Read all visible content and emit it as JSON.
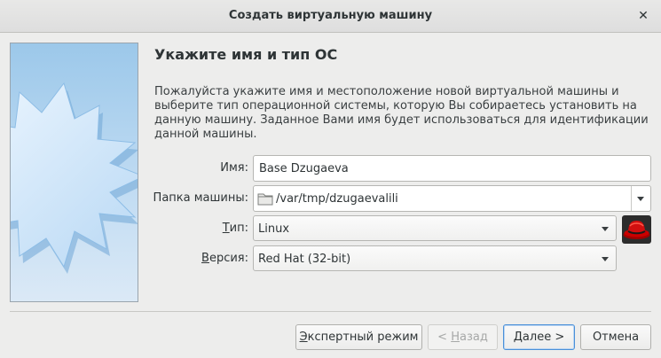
{
  "window": {
    "title": "Создать виртуальную машину",
    "close_glyph": "✕"
  },
  "page": {
    "heading": "Укажите имя и тип ОС",
    "description": "Пожалуйста укажите имя и местоположение новой виртуальной машины и выберите тип операционной системы, которую Вы собираетесь установить на данную машину. Заданное Вами имя будет использоваться для идентификации данной машины."
  },
  "form": {
    "name": {
      "label": "Имя:",
      "value": "Base Dzugaeva"
    },
    "folder": {
      "label": "Папка машины:",
      "value": "/var/tmp/dzugaevalili",
      "icon": "folder-icon"
    },
    "type": {
      "label_mnemonic": "Т",
      "label_rest": "ип:",
      "value": "Linux",
      "icon": "redhat-icon"
    },
    "version": {
      "label_mnemonic": "В",
      "label_rest": "ерсия:",
      "value": "Red Hat (32-bit)"
    }
  },
  "buttons": {
    "expert": {
      "mnemonic": "Э",
      "rest": "кспертный режим"
    },
    "back": {
      "prefix": "< ",
      "mnemonic": "Н",
      "rest": "азад",
      "enabled": false
    },
    "next": {
      "mnemonic": "Д",
      "rest": "алее >"
    },
    "cancel": {
      "label": "Отмена"
    }
  },
  "colors": {
    "accent": "#4a90d9",
    "redhat": "#cc0000"
  }
}
